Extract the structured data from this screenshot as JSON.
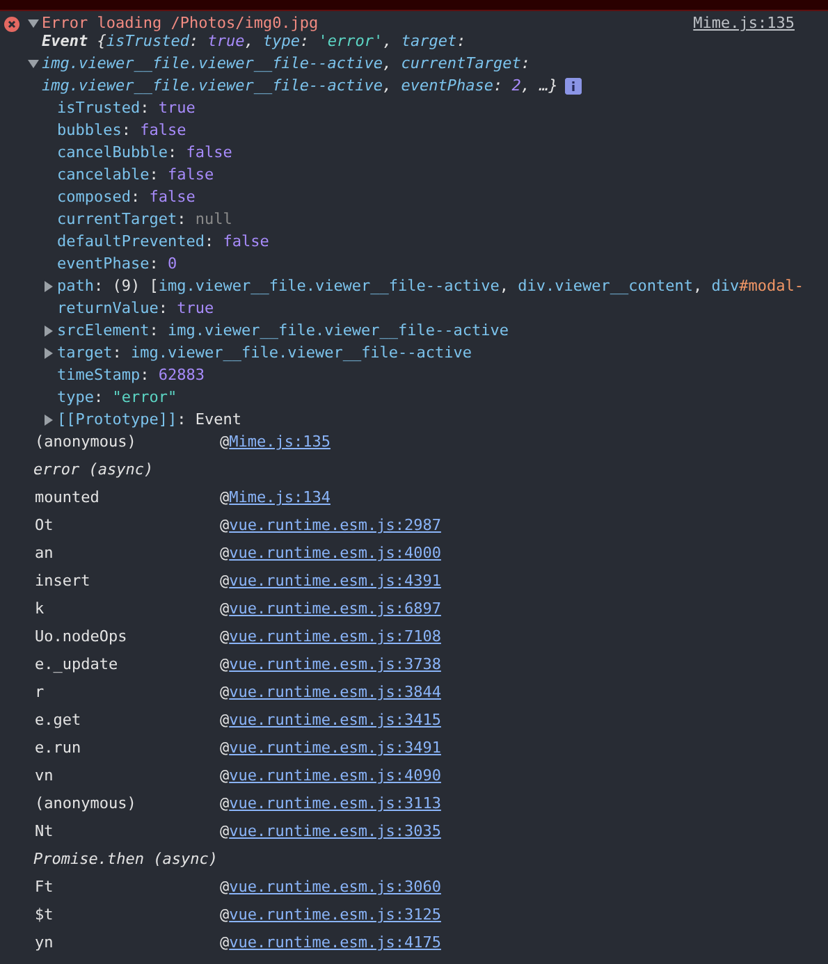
{
  "message": {
    "text": "Error loading /Photos/img0.jpg",
    "source": "Mime.js:135",
    "expanded": true
  },
  "summary": [
    {
      "tokens": [
        {
          "text": "Event ",
          "kind": "class"
        },
        {
          "text": "{",
          "kind": "plain"
        },
        {
          "text": "isTrusted",
          "kind": "key"
        },
        {
          "text": ": ",
          "kind": "plain"
        },
        {
          "text": "true",
          "kind": "bool"
        },
        {
          "text": ", ",
          "kind": "plain"
        },
        {
          "text": "type",
          "kind": "key"
        },
        {
          "text": ": ",
          "kind": "plain"
        },
        {
          "text": "'error'",
          "kind": "string"
        },
        {
          "text": ", ",
          "kind": "plain"
        },
        {
          "text": "target",
          "kind": "key"
        },
        {
          "text": ":",
          "kind": "plain"
        }
      ]
    },
    {
      "expanded": true,
      "tokens": [
        {
          "text": "img.viewer__file.viewer__file--active",
          "kind": "object"
        },
        {
          "text": ", ",
          "kind": "plain"
        },
        {
          "text": "currentTarget",
          "kind": "key"
        },
        {
          "text": ":",
          "kind": "plain"
        }
      ]
    },
    {
      "info": true,
      "tokens": [
        {
          "text": "img.viewer__file.viewer__file--active",
          "kind": "object"
        },
        {
          "text": ", ",
          "kind": "plain"
        },
        {
          "text": "eventPhase",
          "kind": "key"
        },
        {
          "text": ": ",
          "kind": "plain"
        },
        {
          "text": "2",
          "kind": "bool"
        },
        {
          "text": ", …}",
          "kind": "plain"
        }
      ]
    }
  ],
  "properties": [
    {
      "tokens": [
        {
          "text": "isTrusted",
          "kind": "key"
        },
        {
          "text": ": ",
          "kind": "plain"
        },
        {
          "text": "true",
          "kind": "bool"
        }
      ]
    },
    {
      "tokens": [
        {
          "text": "bubbles",
          "kind": "key"
        },
        {
          "text": ": ",
          "kind": "plain"
        },
        {
          "text": "false",
          "kind": "bool"
        }
      ]
    },
    {
      "tokens": [
        {
          "text": "cancelBubble",
          "kind": "key"
        },
        {
          "text": ": ",
          "kind": "plain"
        },
        {
          "text": "false",
          "kind": "bool"
        }
      ]
    },
    {
      "tokens": [
        {
          "text": "cancelable",
          "kind": "key"
        },
        {
          "text": ": ",
          "kind": "plain"
        },
        {
          "text": "false",
          "kind": "bool"
        }
      ]
    },
    {
      "tokens": [
        {
          "text": "composed",
          "kind": "key"
        },
        {
          "text": ": ",
          "kind": "plain"
        },
        {
          "text": "false",
          "kind": "bool"
        }
      ]
    },
    {
      "tokens": [
        {
          "text": "currentTarget",
          "kind": "key"
        },
        {
          "text": ": ",
          "kind": "plain"
        },
        {
          "text": "null",
          "kind": "null"
        }
      ]
    },
    {
      "tokens": [
        {
          "text": "defaultPrevented",
          "kind": "key"
        },
        {
          "text": ": ",
          "kind": "plain"
        },
        {
          "text": "false",
          "kind": "bool"
        }
      ]
    },
    {
      "tokens": [
        {
          "text": "eventPhase",
          "kind": "key"
        },
        {
          "text": ": ",
          "kind": "plain"
        },
        {
          "text": "0",
          "kind": "bool"
        }
      ]
    },
    {
      "expanded": false,
      "tokens": [
        {
          "text": "path",
          "kind": "key"
        },
        {
          "text": ": (9) [",
          "kind": "plain"
        },
        {
          "text": "img.viewer__file.viewer__file--active",
          "kind": "node"
        },
        {
          "text": ", ",
          "kind": "plain"
        },
        {
          "text": "div.viewer__content",
          "kind": "node"
        },
        {
          "text": ", ",
          "kind": "plain"
        },
        {
          "text": "div",
          "kind": "node"
        },
        {
          "text": "#modal-",
          "kind": "id"
        }
      ]
    },
    {
      "tokens": [
        {
          "text": "returnValue",
          "kind": "key"
        },
        {
          "text": ": ",
          "kind": "plain"
        },
        {
          "text": "true",
          "kind": "bool"
        }
      ]
    },
    {
      "expanded": false,
      "tokens": [
        {
          "text": "srcElement",
          "kind": "key"
        },
        {
          "text": ": ",
          "kind": "plain"
        },
        {
          "text": "img.viewer__file.viewer__file--active",
          "kind": "node"
        }
      ]
    },
    {
      "expanded": false,
      "tokens": [
        {
          "text": "target",
          "kind": "key"
        },
        {
          "text": ": ",
          "kind": "plain"
        },
        {
          "text": "img.viewer__file.viewer__file--active",
          "kind": "node"
        }
      ]
    },
    {
      "tokens": [
        {
          "text": "timeStamp",
          "kind": "key"
        },
        {
          "text": ": ",
          "kind": "plain"
        },
        {
          "text": "62883",
          "kind": "bool"
        }
      ]
    },
    {
      "tokens": [
        {
          "text": "type",
          "kind": "key"
        },
        {
          "text": ": ",
          "kind": "plain"
        },
        {
          "text": "\"error\"",
          "kind": "string"
        }
      ]
    },
    {
      "expanded": false,
      "tokens": [
        {
          "text": "[[Prototype]]",
          "kind": "key"
        },
        {
          "text": ": ",
          "kind": "plain"
        },
        {
          "text": "Event",
          "kind": "class"
        }
      ]
    }
  ],
  "stack": [
    {
      "kind": "frame",
      "function": "(anonymous)",
      "at": "@",
      "location": "Mime.js:135"
    },
    {
      "kind": "async",
      "label": "error (async)"
    },
    {
      "kind": "frame",
      "function": "mounted",
      "at": "@",
      "location": "Mime.js:134"
    },
    {
      "kind": "frame",
      "function": "Ot",
      "at": "@",
      "location": "vue.runtime.esm.js:2987"
    },
    {
      "kind": "frame",
      "function": "an",
      "at": "@",
      "location": "vue.runtime.esm.js:4000"
    },
    {
      "kind": "frame",
      "function": "insert",
      "at": "@",
      "location": "vue.runtime.esm.js:4391"
    },
    {
      "kind": "frame",
      "function": "k",
      "at": "@",
      "location": "vue.runtime.esm.js:6897"
    },
    {
      "kind": "frame",
      "function": "Uo.nodeOps",
      "at": "@",
      "location": "vue.runtime.esm.js:7108"
    },
    {
      "kind": "frame",
      "function": "e._update",
      "at": "@",
      "location": "vue.runtime.esm.js:3738"
    },
    {
      "kind": "frame",
      "function": "r",
      "at": "@",
      "location": "vue.runtime.esm.js:3844"
    },
    {
      "kind": "frame",
      "function": "e.get",
      "at": "@",
      "location": "vue.runtime.esm.js:3415"
    },
    {
      "kind": "frame",
      "function": "e.run",
      "at": "@",
      "location": "vue.runtime.esm.js:3491"
    },
    {
      "kind": "frame",
      "function": "vn",
      "at": "@",
      "location": "vue.runtime.esm.js:4090"
    },
    {
      "kind": "frame",
      "function": "(anonymous)",
      "at": "@",
      "location": "vue.runtime.esm.js:3113"
    },
    {
      "kind": "frame",
      "function": "Nt",
      "at": "@",
      "location": "vue.runtime.esm.js:3035"
    },
    {
      "kind": "async",
      "label": "Promise.then (async)"
    },
    {
      "kind": "frame",
      "function": "Ft",
      "at": "@",
      "location": "vue.runtime.esm.js:3060"
    },
    {
      "kind": "frame",
      "function": "$t",
      "at": "@",
      "location": "vue.runtime.esm.js:3125"
    },
    {
      "kind": "frame",
      "function": "yn",
      "at": "@",
      "location": "vue.runtime.esm.js:4175"
    }
  ]
}
